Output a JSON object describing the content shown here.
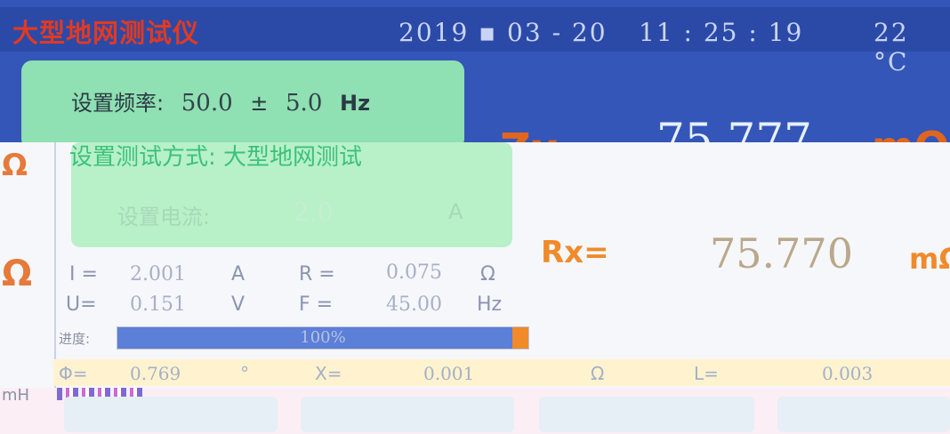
{
  "header": {
    "title": "大型地网测试仪",
    "date": "2019 ▪ 03 - 20",
    "time": "11 : 25 : 19",
    "temperature": "22 °C"
  },
  "settings": {
    "frequency_label": "设置频率:",
    "frequency_value": "50.0",
    "frequency_pm": "±",
    "frequency_tol": "5.0",
    "frequency_unit": "Hz",
    "mode_label": "设置测试方式:",
    "mode_value": "大型地网测试",
    "current_label": "设置电流:",
    "current_value": "2.0",
    "current_unit": "A"
  },
  "readings": {
    "zx_label": "Zx=",
    "zx_value": "75.777",
    "zx_unit": "mΩ",
    "rx_label": "Rx=",
    "rx_value": "75.770",
    "rx_unit": "mΩ",
    "left_unit": "Ω",
    "I_label": "I =",
    "I_value": "2.001",
    "I_unit": "A",
    "R_label": "R =",
    "R_value": "0.075",
    "R_unit": "Ω",
    "U_label": "U=",
    "U_value": "0.151",
    "U_unit": "V",
    "F_label": "F =",
    "F_value": "45.00",
    "F_unit": "Hz",
    "phi_label": "Φ=",
    "phi_value": "0.769",
    "phi_unit": "°",
    "X_label": "X=",
    "X_value": "0.001",
    "X_unit": "Ω",
    "L_label": "L=",
    "L_value": "0.003",
    "L_unit": "mH"
  },
  "progress": {
    "label": "进度:",
    "percent_text": "100%",
    "fraction": 1.0
  },
  "colors": {
    "header_bg": "#2b4aa8",
    "title_red": "#e03a22",
    "accent_orange": "#f08a2a",
    "panel_green": "#8fe0b2",
    "progress_blue": "#5c7fd8"
  }
}
